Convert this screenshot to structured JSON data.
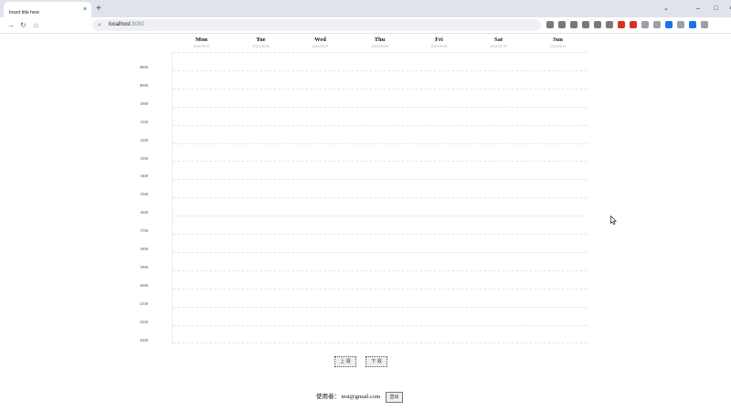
{
  "browser": {
    "tab_title": "Insert title here",
    "close_glyph": "×",
    "new_tab_glyph": "+",
    "url_host": "localhost",
    "url_port": ":8080",
    "nav": {
      "back": "→",
      "reload": "↻",
      "home": "⌂"
    },
    "window": {
      "dropdown": "⌄",
      "minimize": "–",
      "maximize": "□",
      "close": "×"
    },
    "extension_colors": [
      "#7a7a7a",
      "#7a7a7a",
      "#7a7a7a",
      "#7a7a7a",
      "#7a7a7a",
      "#7a7a7a",
      "#d93025",
      "#d93025",
      "#9aa0a6",
      "#9aa0a6",
      "#1a73e8",
      "#9aa0a6",
      "#1a73e8",
      "#9aa0a6"
    ]
  },
  "calendar": {
    "days": [
      {
        "name": "Mon",
        "date": "2024.08.05"
      },
      {
        "name": "Tue",
        "date": "2024.08.06"
      },
      {
        "name": "Wed",
        "date": "2024.08.07"
      },
      {
        "name": "Thu",
        "date": "2024.08.08"
      },
      {
        "name": "Fri",
        "date": "2024.08.09"
      },
      {
        "name": "Sat",
        "date": "2024.08.10"
      },
      {
        "name": "Sun",
        "date": "2024.08.11"
      }
    ],
    "hours": [
      "0800",
      "0900",
      "1000",
      "1100",
      "1200",
      "1300",
      "1400",
      "1500",
      "1600",
      "1700",
      "1800",
      "1900",
      "2000",
      "2100",
      "2200",
      "2300"
    ]
  },
  "controls": {
    "prev_week": "上 週",
    "next_week": "下 週"
  },
  "footer": {
    "label": "使用者：",
    "email": "test@gmail.com",
    "logout": "登出"
  }
}
